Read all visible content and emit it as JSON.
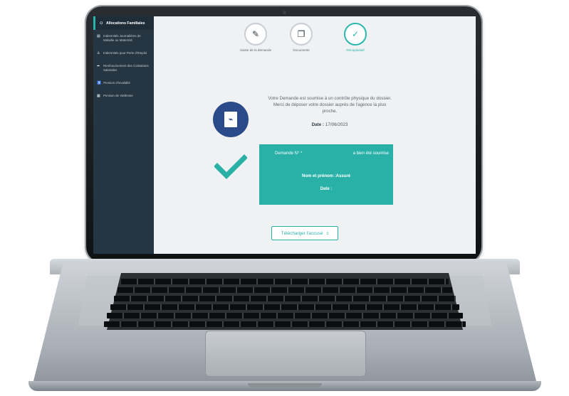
{
  "sidebar": {
    "header": "Allocations Familiales",
    "items": [
      {
        "icon": "document-icon",
        "label": "Indemnités Journalières de Maladie ou Maternité"
      },
      {
        "icon": "person-icon",
        "label": "Indemnités pour Perte d'Emploi"
      },
      {
        "icon": "share-icon",
        "label": "Remboursement des Cotisations Salariales"
      },
      {
        "icon": "wheelchair-icon",
        "label": "Pension d'Invalidité"
      },
      {
        "icon": "grid-icon",
        "label": "Pension de Vieillesse"
      }
    ]
  },
  "steps": [
    {
      "icon": "pencil-icon",
      "label": "Saisie de la demande",
      "state": "completed"
    },
    {
      "icon": "copy-icon",
      "label": "Documents",
      "state": "completed"
    },
    {
      "icon": "check-icon",
      "label": "Récapitulatif",
      "state": "active"
    }
  ],
  "confirmation": {
    "message": "Votre Demande est soumise à un contrôle physique du dossier. Merci de déposer votre dossier auprès de l'agence la plus proche.",
    "date_label": "Date :",
    "date_value": "17/06/2023"
  },
  "card": {
    "demande_label": "Demande N° *",
    "demande_status": "a bien été soumise",
    "nom_label": "Nom et prénom :Assuré",
    "date_label": "Date :"
  },
  "download_button": {
    "label": "Télécharger l'accusé"
  },
  "colors": {
    "accent": "#29b1a8",
    "sidebar": "#253642",
    "pdf_badge": "#2b4a8a"
  }
}
